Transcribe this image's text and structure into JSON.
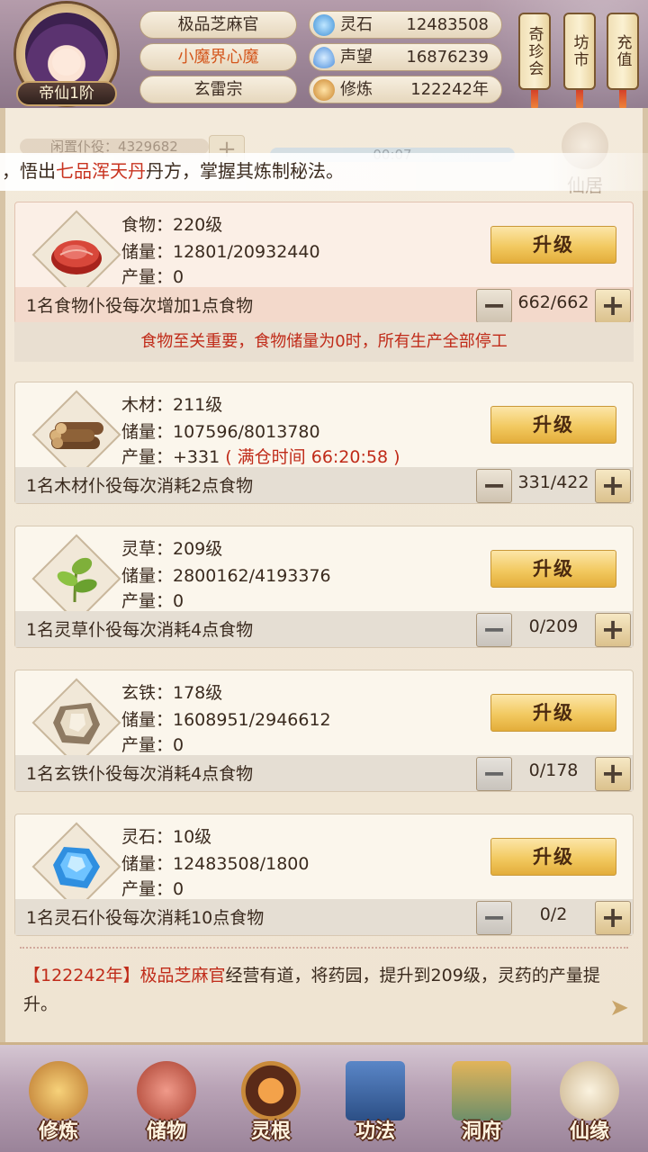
{
  "player": {
    "rank": "帝仙1阶",
    "title": "极品芝麻官",
    "demon": "小魔界心魔",
    "sect": "玄雷宗"
  },
  "resources_top": [
    {
      "label": "灵石",
      "value": "12483508",
      "icon": "spirit-stone-icon",
      "color": "#4aa7e8"
    },
    {
      "label": "声望",
      "value": "16876239",
      "icon": "reputation-icon",
      "color": "#5fa0e6"
    },
    {
      "label": "修炼",
      "value": "122242年",
      "icon": "cultivation-icon",
      "color": "#d99a3f"
    }
  ],
  "side_tabs": [
    "奇珍会",
    "坊市",
    "充值"
  ],
  "ghost": {
    "servant_label": "闲置仆役",
    "servant_value": "4329682",
    "timer": "00:07",
    "xianju": "仙居"
  },
  "banner": {
    "prefix": "，悟出",
    "highlight": "七品浑天丹",
    "suffix": "丹方，掌握其炼制秘法。"
  },
  "upgrade_label": "升级",
  "cards": [
    {
      "kind": "food",
      "name_line": "食物：220级",
      "storage_line": "储量：12801/20932440",
      "output_line": "产量：0",
      "output_extra": "",
      "servant_desc": "1名食物仆役每次增加1点食物",
      "count": "662/662",
      "icon": "meat-icon"
    },
    {
      "kind": "wood",
      "name_line": "木材：211级",
      "storage_line": "储量：107596/8013780",
      "output_line": "产量：+331",
      "output_extra": "( 满仓时间 66:20:58 )",
      "servant_desc": "1名木材仆役每次消耗2点食物",
      "count": "331/422",
      "icon": "wood-logs-icon"
    },
    {
      "kind": "herb",
      "name_line": "灵草：209级",
      "storage_line": "储量：2800162/4193376",
      "output_line": "产量：0",
      "output_extra": "",
      "servant_desc": "1名灵草仆役每次消耗4点食物",
      "count": "0/209",
      "icon": "herb-icon"
    },
    {
      "kind": "iron",
      "name_line": "玄铁：178级",
      "storage_line": "储量：1608951/2946612",
      "output_line": "产量：0",
      "output_extra": "",
      "servant_desc": "1名玄铁仆役每次消耗4点食物",
      "count": "0/178",
      "icon": "iron-ore-icon"
    },
    {
      "kind": "stone",
      "name_line": "灵石：10级",
      "storage_line": "储量：12483508/1800",
      "output_line": "产量：0",
      "output_extra": "",
      "servant_desc": "1名灵石仆役每次消耗10点食物",
      "count": "0/2",
      "icon": "crystal-icon"
    }
  ],
  "food_warning": "食物至关重要，食物储量为0时，所有生产全部停工",
  "log": {
    "year": "【122242年】",
    "actor": "极品芝麻官",
    "text": "经营有道，将药园，提升到209级，灵药的产量提升。"
  },
  "nav": [
    {
      "label": "修炼",
      "icon": "cultivate-icon"
    },
    {
      "label": "储物",
      "icon": "storage-bag-icon"
    },
    {
      "label": "灵根",
      "icon": "spirit-root-icon"
    },
    {
      "label": "功法",
      "icon": "scripture-book-icon"
    },
    {
      "label": "洞府",
      "icon": "cave-mansion-icon"
    },
    {
      "label": "仙缘",
      "icon": "gourd-icon"
    }
  ]
}
